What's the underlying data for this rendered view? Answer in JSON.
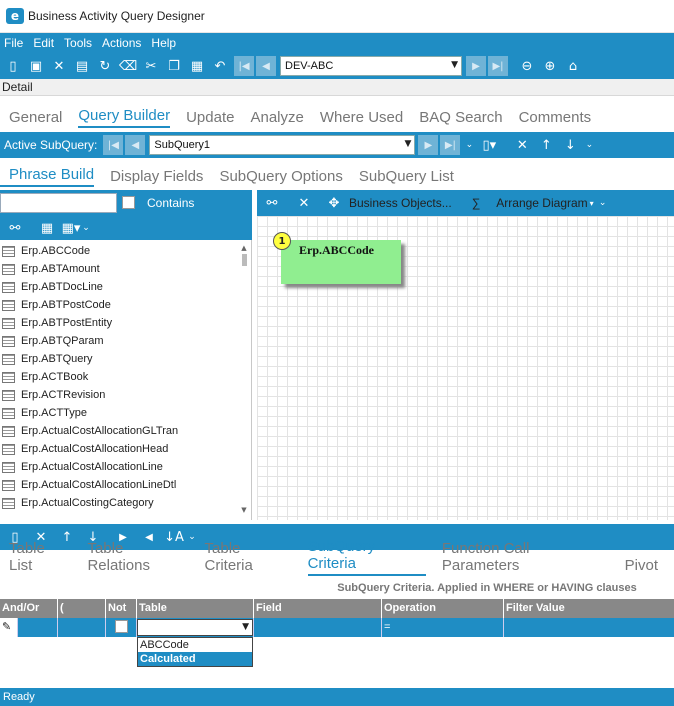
{
  "window": {
    "title": "Business Activity Query Designer",
    "logo_letter": "e"
  },
  "menu": [
    "File",
    "Edit",
    "Tools",
    "Actions",
    "Help"
  ],
  "toolbar": {
    "company": "DEV-ABC"
  },
  "detail_label": "Detail",
  "main_tabs": [
    "General",
    "Query Builder",
    "Update",
    "Analyze",
    "Where Used",
    "BAQ Search",
    "Comments"
  ],
  "subquery_bar": {
    "label": "Active SubQuery:",
    "value": "SubQuery1"
  },
  "sub_tabs": [
    "Phrase Build",
    "Display Fields",
    "SubQuery Options",
    "SubQuery List"
  ],
  "table_search": {
    "value": "",
    "contains_label": "Contains"
  },
  "table_list": [
    "Erp.ABCCode",
    "Erp.ABTAmount",
    "Erp.ABTDocLine",
    "Erp.ABTPostCode",
    "Erp.ABTPostEntity",
    "Erp.ABTQParam",
    "Erp.ABTQuery",
    "Erp.ACTBook",
    "Erp.ACTRevision",
    "Erp.ACTType",
    "Erp.ActualCostAllocationGLTran",
    "Erp.ActualCostAllocationHead",
    "Erp.ActualCostAllocationLine",
    "Erp.ActualCostAllocationLineDtl",
    "Erp.ActualCostingCategory"
  ],
  "canvas_toolbar": {
    "business_objects": "Business Objects...",
    "sigma": "∑",
    "arrange": "Arrange Diagram"
  },
  "diagram_node": {
    "number": "1",
    "name": "Erp.ABCCode"
  },
  "bottom_tabs": [
    "Table List",
    "Table Relations",
    "Table Criteria",
    "SubQuery Criteria",
    "Function Call Parameters",
    "Pivot"
  ],
  "criteria_caption": "SubQuery Criteria. Applied in WHERE or HAVING clauses",
  "criteria_columns": [
    "And/Or",
    "(",
    "Not",
    "Table",
    "Field",
    "Operation",
    "Filter Value"
  ],
  "criteria_row": {
    "operation": "="
  },
  "table_dropdown_options": [
    "ABCCode",
    "Calculated"
  ],
  "status": "Ready"
}
